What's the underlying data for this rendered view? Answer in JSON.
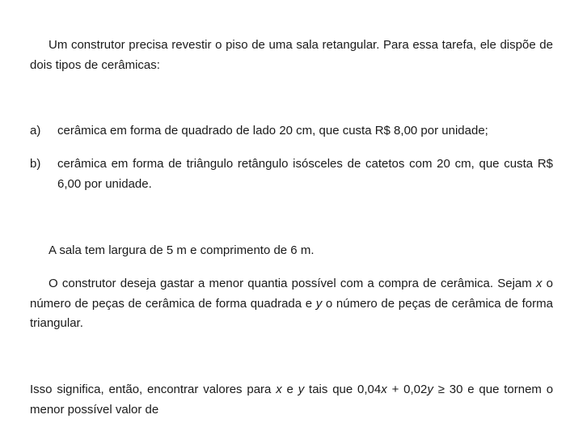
{
  "intro": "Um construtor precisa revestir o piso de uma sala retangular. Para essa tarefa, ele dispõe de dois tipos de cerâmicas:",
  "items": [
    {
      "label": "a)",
      "text": "cerâmica em forma de quadrado de lado 20 cm, que custa R$ 8,00 por unidade;"
    },
    {
      "label": "b)",
      "text": "cerâmica em forma de triângulo retângulo isósceles de catetos com 20 cm, que custa R$ 6,00 por unidade."
    }
  ],
  "room": "A sala tem largura de 5 m e comprimento de 6 m.",
  "builder": {
    "p1": "O construtor deseja gastar a menor quantia possível com a compra de cerâmica. Sejam",
    "var_x": "x",
    "p2": "o número de peças de cerâmica de forma quadrada e",
    "var_y": "y",
    "p3": "o número de peças de cerâmica de forma triangular."
  },
  "conclusion": {
    "p1": "Isso significa, então, encontrar valores para",
    "var_x": "x",
    "and": "e",
    "var_y": "y",
    "p2": "tais que 0,04",
    "var_x2": "x",
    "p3": "+ 0,02",
    "var_y2": "y",
    "p4": "≥ 30 e que tornem o menor possível valor de"
  }
}
